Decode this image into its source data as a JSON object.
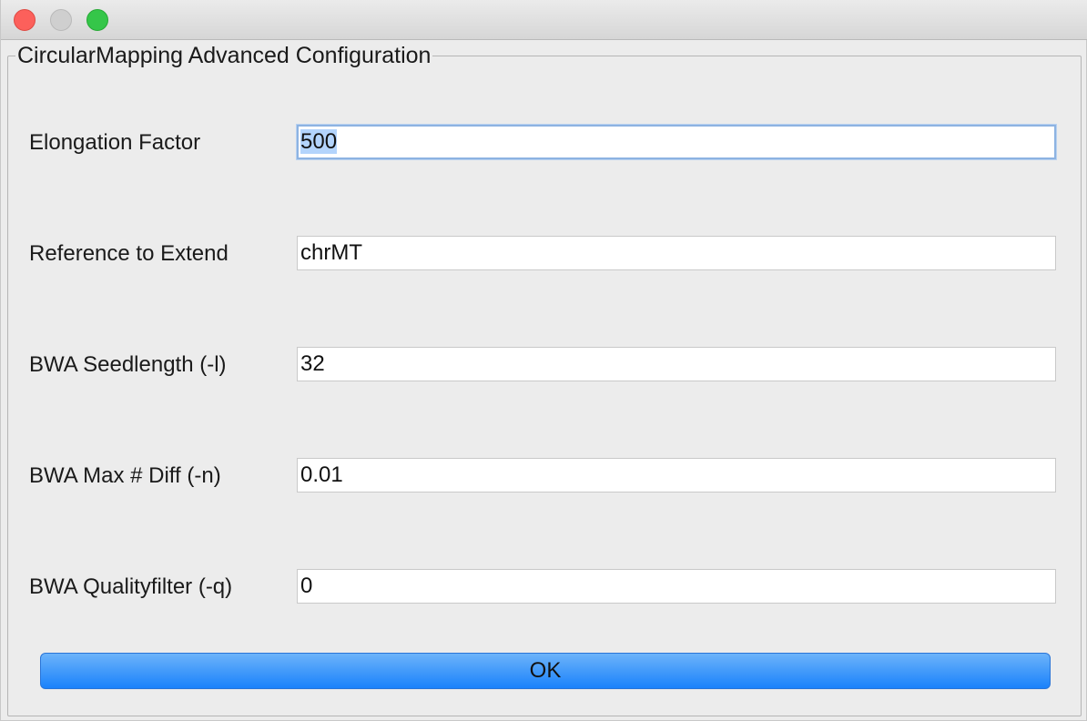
{
  "dialog": {
    "title": "CircularMapping Advanced Configuration"
  },
  "fields": [
    {
      "label": "Elongation Factor",
      "value": "500"
    },
    {
      "label": "Reference to Extend",
      "value": "chrMT"
    },
    {
      "label": "BWA Seedlength (-l)",
      "value": "32"
    },
    {
      "label": "BWA Max # Diff (-n)",
      "value": "0.01"
    },
    {
      "label": "BWA Qualityfilter (-q)",
      "value": "0"
    }
  ],
  "ok_label": "OK"
}
